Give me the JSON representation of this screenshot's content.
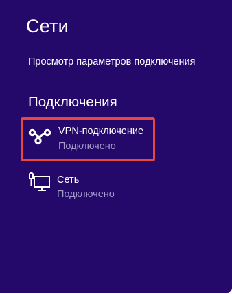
{
  "panel": {
    "title": "Сети",
    "view_settings_link": "Просмотр параметров подключения",
    "section_heading": "Подключения"
  },
  "connections": [
    {
      "name": "VPN-подключение",
      "status": "Подключено",
      "icon": "vpn-icon",
      "highlighted": true
    },
    {
      "name": "Сеть",
      "status": "Подключено",
      "icon": "wired-network-icon",
      "highlighted": false
    }
  ],
  "colors": {
    "panel_background": "#24096a",
    "status_text": "#a49ccd",
    "highlight_border": "#e8463e"
  }
}
